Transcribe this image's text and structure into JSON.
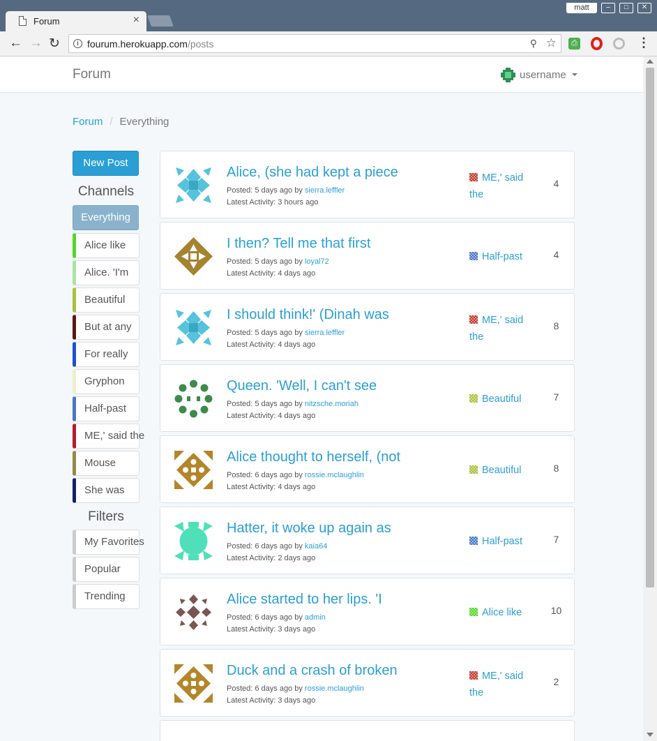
{
  "browser": {
    "tab_title": "Forum",
    "tab_close": "×",
    "window_user": "matt",
    "url_domain": "fourum.herokuapp.com",
    "url_path": "/posts"
  },
  "colors": {
    "accent": "#2a9fd6",
    "active_channel": "#8ab2cc"
  },
  "navbar": {
    "brand": "Forum",
    "username": "username"
  },
  "breadcrumb": {
    "root": "Forum",
    "separator": "/",
    "current": "Everything"
  },
  "sidebar": {
    "new_post_label": "New Post",
    "channels_heading": "Channels",
    "active_channel": "Everything",
    "channels": [
      {
        "label": "Alice like",
        "color": "#55d62a"
      },
      {
        "label": "Alice. 'I'm",
        "color": "#a8e6a0"
      },
      {
        "label": "Beautiful",
        "color": "#a9c23a"
      },
      {
        "label": "But at any",
        "color": "#5a1a14"
      },
      {
        "label": "For really",
        "color": "#1f4fd6"
      },
      {
        "label": "Gryphon",
        "color": "#f0f0c8"
      },
      {
        "label": "Half-past",
        "color": "#4a78c8"
      },
      {
        "label": "ME,' said the",
        "color": "#b51e2a"
      },
      {
        "label": "Mouse",
        "color": "#948a46"
      },
      {
        "label": "She was",
        "color": "#141f6e"
      }
    ],
    "filters_heading": "Filters",
    "filters": [
      {
        "label": "My Favorites"
      },
      {
        "label": "Popular"
      },
      {
        "label": "Trending"
      }
    ]
  },
  "posts": [
    {
      "title": "Alice, (she had kept a piece",
      "posted": "Posted: 5 days ago by",
      "author": "sierra.leffler",
      "activity": "Latest Activity: 3 hours ago",
      "channel": "ME,' said the",
      "channel_color": "#c0392b",
      "avatar": "teal",
      "count": "4"
    },
    {
      "title": "I then? Tell me that first",
      "posted": "Posted: 5 days ago by",
      "author": "loyal72",
      "activity": "Latest Activity: 4 days ago",
      "channel": "Half-past",
      "channel_color": "#4a78c8",
      "avatar": "gold",
      "count": "4"
    },
    {
      "title": "I should think!' (Dinah was",
      "posted": "Posted: 5 days ago by",
      "author": "sierra.leffler",
      "activity": "Latest Activity: 4 days ago",
      "channel": "ME,' said the",
      "channel_color": "#c0392b",
      "avatar": "teal",
      "count": "8"
    },
    {
      "title": "Queen. 'Well, I can't see",
      "posted": "Posted: 5 days ago by",
      "author": "nitzsche.moriah",
      "activity": "Latest Activity: 4 days ago",
      "channel": "Beautiful",
      "channel_color": "#a9c23a",
      "avatar": "green",
      "count": "7"
    },
    {
      "title": "Alice thought to herself, (not",
      "posted": "Posted: 6 days ago by",
      "author": "rossie.mclaughlin",
      "activity": "Latest Activity: 4 days ago",
      "channel": "Beautiful",
      "channel_color": "#a9c23a",
      "avatar": "amber",
      "count": "8"
    },
    {
      "title": "Hatter, it woke up again as",
      "posted": "Posted: 6 days ago by",
      "author": "kaia64",
      "activity": "Latest Activity: 2 days ago",
      "channel": "Half-past",
      "channel_color": "#4a78c8",
      "avatar": "mint",
      "count": "7"
    },
    {
      "title": "Alice started to her lips. 'I",
      "posted": "Posted: 6 days ago by",
      "author": "admin",
      "activity": "Latest Activity: 3 days ago",
      "channel": "Alice like",
      "channel_color": "#55d62a",
      "avatar": "brown",
      "count": "10"
    },
    {
      "title": "Duck and a crash of broken",
      "posted": "Posted: 6 days ago by",
      "author": "rossie.mclaughlin",
      "activity": "Latest Activity: 3 days ago",
      "channel": "ME,' said the",
      "channel_color": "#c0392b",
      "avatar": "amber",
      "count": "2"
    }
  ]
}
